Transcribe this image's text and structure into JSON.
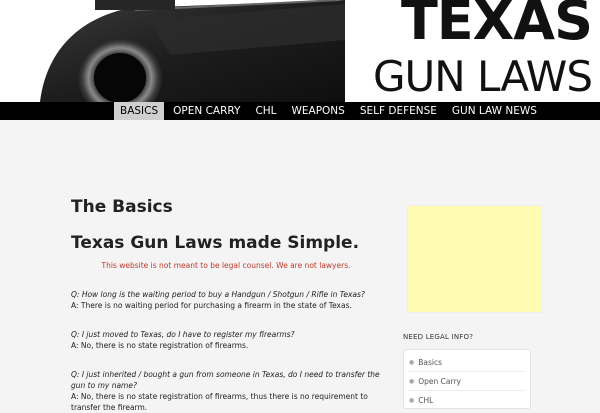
{
  "header": {
    "logo_line1": "TEXAS",
    "logo_line2": "GUN LAWS"
  },
  "nav": {
    "items": [
      "BASICS",
      "OPEN CARRY",
      "CHL",
      "WEAPONS",
      "SELF DEFENSE",
      "GUN LAW NEWS"
    ],
    "active_index": 0
  },
  "main": {
    "page_title": "The Basics",
    "headline": "Texas Gun Laws made Simple.",
    "disclaimer": "This website is not meant to be legal counsel. We are not lawyers.",
    "qa": [
      {
        "q": "Q: How long is the waiting period to buy a Handgun / Shotgun / Rifle in Texas?",
        "a": "A: There is no waiting period for purchasing a firearm in the state of Texas."
      },
      {
        "q": "Q: I just moved to Texas, do I have to register my firearms?",
        "a": "A: No, there is no state registration of firearms."
      },
      {
        "q": "Q: I just inherited / bought a gun from someone in Texas, do I need to transfer the gun to my name?",
        "a": "A: No, there is no state registration of firearms, thus there is no requirement to transfer the firearm."
      }
    ]
  },
  "sidebar": {
    "widget_title": "NEED LEGAL INFO?",
    "links": [
      "Basics",
      "Open Carry",
      "CHL"
    ]
  },
  "colors": {
    "nav_bg": "#000000",
    "nav_active_bg": "#cfcfcf",
    "disclaimer": "#c0392b",
    "ad_bg": "#fffbb3"
  }
}
